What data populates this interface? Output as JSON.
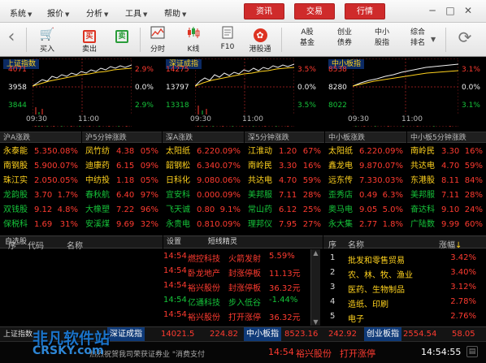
{
  "menubar": {
    "items": [
      "系统",
      "报价",
      "分析",
      "工具",
      "帮助"
    ],
    "tabs": [
      "资讯",
      "交易",
      "行情"
    ],
    "colors": {
      "tab": "#cf2b2b"
    }
  },
  "toolbar": {
    "items": [
      {
        "label": "买入",
        "icon": "cart-icon"
      },
      {
        "label": "卖出",
        "icon": "sell-icon"
      },
      {
        "label": "分时",
        "icon": "timeshare-chart-icon"
      },
      {
        "label": "K线",
        "icon": "candlestick-icon"
      },
      {
        "label": "F10",
        "icon": "f10-icon"
      },
      {
        "label": "港股通",
        "icon": "hk-connect-icon"
      }
    ],
    "text_items": [
      {
        "line1": "A股",
        "line2": "基金"
      },
      {
        "line1": "创业",
        "line2": "债券"
      },
      {
        "line1": "中小",
        "line2": "股指"
      },
      {
        "line1": "综合",
        "line2": "排名"
      }
    ]
  },
  "indices": [
    {
      "name": "上证指数",
      "high": "4071",
      "mid": "3958",
      "low": "3844",
      "pct_high": "2.9%",
      "pct_mid": "0.0%",
      "pct_low": "2.9%"
    },
    {
      "name": "深证成指",
      "high": "14275",
      "mid": "13797",
      "low": "13318",
      "pct_high": "3.5%",
      "pct_mid": "0.0%",
      "pct_low": "3.5%"
    },
    {
      "name": "中小板指",
      "high": "8538",
      "mid": "8280",
      "low": "8022",
      "pct_high": "3.1%",
      "pct_mid": "0.0%",
      "pct_low": "3.1%"
    }
  ],
  "time_axis": [
    "09:30",
    "11:00",
    "09:30",
    "11:00",
    "09:30",
    "11:00"
  ],
  "movers": {
    "headers": [
      "沪A涨跌",
      "沪5分钟涨跌",
      "深A涨跌",
      "深5分钟涨跌",
      "中小板涨跌",
      "中小板5分钟涨跌"
    ],
    "tables": [
      [
        [
          "永泰能",
          "5.35",
          "0.08%"
        ],
        [
          "南钢股",
          "5.90",
          "0.07%"
        ],
        [
          "珠江实",
          "2.05",
          "0.05%"
        ],
        [
          "龙韵股",
          "3.70",
          "1.7%"
        ],
        [
          "双钱股",
          "9.12",
          "4.8%"
        ],
        [
          "保税科",
          "1.69",
          "31%"
        ]
      ],
      [
        [
          "凤竹纺",
          "4.38",
          "05%"
        ],
        [
          "迪康药",
          "6.15",
          "09%"
        ],
        [
          "中纺投",
          "1.18",
          "05%"
        ],
        [
          "春秋航",
          "6.40",
          "97%"
        ],
        [
          "大橡塑",
          "7.22",
          "96%"
        ],
        [
          "安溪煤",
          "9.69",
          "32%"
        ]
      ],
      [
        [
          "太阳纸",
          "6.22",
          "0.09%"
        ],
        [
          "韶钢松",
          "6.34",
          "0.07%"
        ],
        [
          "日科化",
          "9.08",
          "0.06%"
        ],
        [
          "宜安科",
          "0.00",
          "0.09%"
        ],
        [
          "飞天诚",
          "0.80",
          "9.1%"
        ],
        [
          "永贵电",
          "0.81",
          "0.09%"
        ]
      ],
      [
        [
          "江淮动",
          "1.20",
          "67%"
        ],
        [
          "南岭民",
          "3.30",
          "16%"
        ],
        [
          "共达电",
          "4.70",
          "59%"
        ],
        [
          "美邦服",
          "7.11",
          "28%"
        ],
        [
          "常山药",
          "6.12",
          "25%"
        ],
        [
          "理邦仪",
          "7.95",
          "27%"
        ]
      ],
      [
        [
          "太阳纸",
          "6.22",
          "0.09%"
        ],
        [
          "鑫龙电",
          "9.87",
          "0.07%"
        ],
        [
          "远东传",
          "7.33",
          "0.03%"
        ],
        [
          "歪秀店",
          "0.49",
          "6.3%"
        ],
        [
          "奥马电",
          "9.05",
          "5.0%"
        ],
        [
          "永大集",
          "2.77",
          "1.8%"
        ]
      ],
      [
        [
          "南岭民",
          "3.30",
          "16%"
        ],
        [
          "共达电",
          "4.70",
          "59%"
        ],
        [
          "东港股",
          "8.11",
          "84%"
        ],
        [
          "美邦服",
          "7.11",
          "28%"
        ],
        [
          "奋达科",
          "9.10",
          "24%"
        ],
        [
          "广陆数",
          "9.99",
          "60%"
        ]
      ]
    ]
  },
  "watchlist": {
    "tab": "自选股",
    "col_seq": "序",
    "col_code": "代码",
    "col_name": "名称"
  },
  "events": {
    "tab_settings": "设置",
    "tab_title": "短线精灵",
    "rows": [
      {
        "time": "14:54",
        "name": "燃控科技",
        "action": "火箭发射",
        "value": "5.59%"
      },
      {
        "time": "14:54",
        "name": "卧龙地产",
        "action": "封涨停板",
        "value": "11.13元"
      },
      {
        "time": "14:54",
        "name": "裕兴股份",
        "action": "封涨停板",
        "value": "36.32元"
      },
      {
        "time": "14:54",
        "name": "亿通科技",
        "action": "步入低谷",
        "value": "-1.44%"
      },
      {
        "time": "14:54",
        "name": "裕兴股份",
        "action": "打开涨停",
        "value": "36.32元"
      }
    ]
  },
  "sectors": {
    "col_seq": "序",
    "col_name": "名称",
    "col_change": "涨幅",
    "rows": [
      {
        "rank": "1",
        "name": "批发和零售贸易",
        "change": "3.42%"
      },
      {
        "rank": "2",
        "name": "农、林、牧、渔业",
        "change": "3.40%"
      },
      {
        "rank": "3",
        "name": "医药、生物制品",
        "change": "3.12%"
      },
      {
        "rank": "4",
        "name": "造纸、印刷",
        "change": "2.78%"
      },
      {
        "rank": "5",
        "name": "电子",
        "change": "2.76%"
      }
    ]
  },
  "ticker": [
    {
      "name": "上证指数",
      "value": "",
      "change": ""
    },
    {
      "name": "深证成指",
      "value": "14021.5",
      "change": "224.82"
    },
    {
      "name": "中小板指",
      "value": "8523.16",
      "change": "242.92"
    },
    {
      "name": "创业板指",
      "value": "2554.54",
      "change": "58.05"
    }
  ],
  "status": {
    "scroll_text": "热烈祝贺我司荣获证券业 \"消费支付",
    "alert_time": "14:54",
    "alert_name": "裕兴股份",
    "alert_action": "打开涨停",
    "clock": "14:54:55"
  },
  "watermark": {
    "line1": "非凡软件站",
    "line2": "CRSKY.com"
  }
}
